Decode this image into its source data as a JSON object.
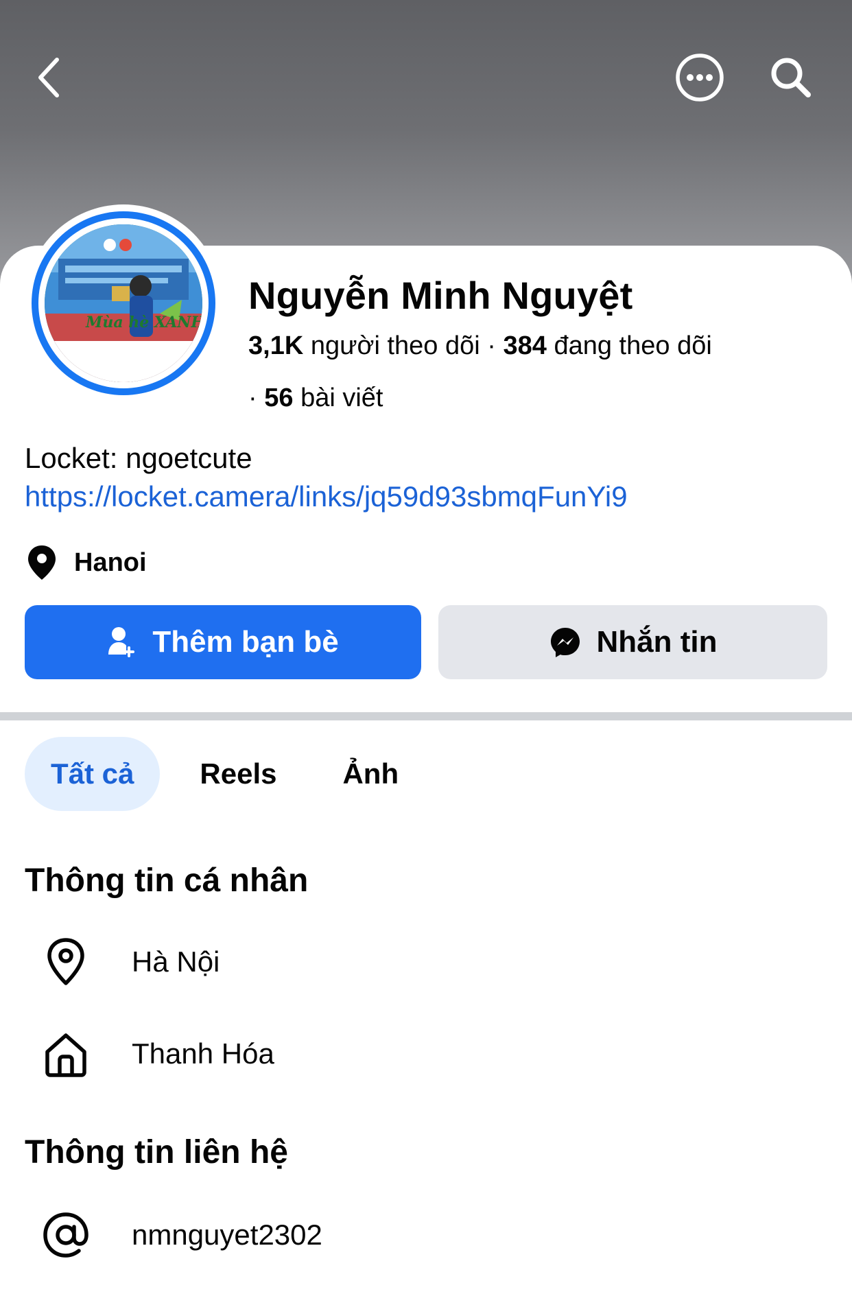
{
  "profile": {
    "name": "Nguyễn Minh Nguyệt",
    "followers_count": "3,1K",
    "followers_label": "người theo dõi",
    "separator": "·",
    "following_count": "384",
    "following_label": "đang theo dõi",
    "posts_count": "56",
    "posts_label": "bài viết",
    "avatar_caption": "Mùa hè XANH"
  },
  "bio": {
    "line1": "Locket: ngoetcute",
    "link": "https://locket.camera/links/jq59d93sbmqFunYi9"
  },
  "location": {
    "text": "Hanoi"
  },
  "actions": {
    "add_friend_label": "Thêm bạn bè",
    "message_label": "Nhắn tin"
  },
  "tabs": [
    {
      "label": "Tất cả",
      "active": true
    },
    {
      "label": "Reels",
      "active": false
    },
    {
      "label": "Ảnh",
      "active": false
    }
  ],
  "personal_info": {
    "title": "Thông tin cá nhân",
    "current_city": "Hà Nội",
    "hometown": "Thanh Hóa"
  },
  "contact_info": {
    "title": "Thông tin liên hệ",
    "username": "nmnguyet2302"
  },
  "icons": {
    "back": "chevron-left-icon",
    "more": "more-horizontal-icon",
    "search": "search-icon",
    "location": "map-pin-icon",
    "add_friend": "add-person-icon",
    "message": "messenger-icon",
    "home": "home-icon",
    "at": "at-sign-icon"
  },
  "colors": {
    "primary_blue": "#1f6ff0",
    "link_blue": "#1b62d6",
    "tab_active_bg": "#e3effe",
    "secondary_button_bg": "#e4e6eb",
    "cover_gray": "#6e6f73"
  }
}
